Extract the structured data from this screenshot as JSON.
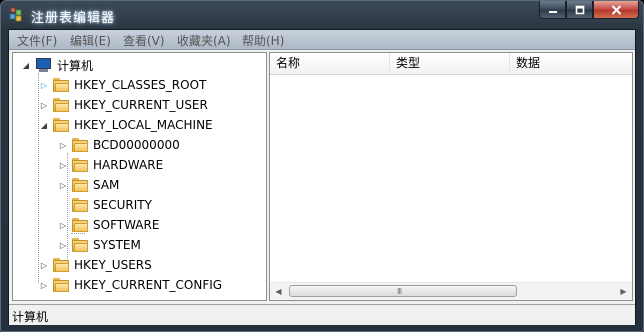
{
  "window": {
    "title": "注册表编辑器"
  },
  "menu": [
    {
      "label": "文件(F)"
    },
    {
      "label": "编辑(E)"
    },
    {
      "label": "查看(V)"
    },
    {
      "label": "收藏夹(A)"
    },
    {
      "label": "帮助(H)"
    }
  ],
  "tree": {
    "root": "计算机",
    "hives": [
      "HKEY_CLASSES_ROOT",
      "HKEY_CURRENT_USER",
      "HKEY_LOCAL_MACHINE",
      "HKEY_USERS",
      "HKEY_CURRENT_CONFIG"
    ],
    "local_machine_children": [
      "BCD00000000",
      "HARDWARE",
      "SAM",
      "SECURITY",
      "SOFTWARE",
      "SYSTEM"
    ]
  },
  "list": {
    "columns": [
      "名称",
      "类型",
      "数据"
    ]
  },
  "scrollbar": {
    "grip": "III"
  },
  "status": {
    "path": "计算机"
  },
  "icons": {
    "app": "registry-editor-icon",
    "root": "computer-icon",
    "node": "folder-icon"
  }
}
